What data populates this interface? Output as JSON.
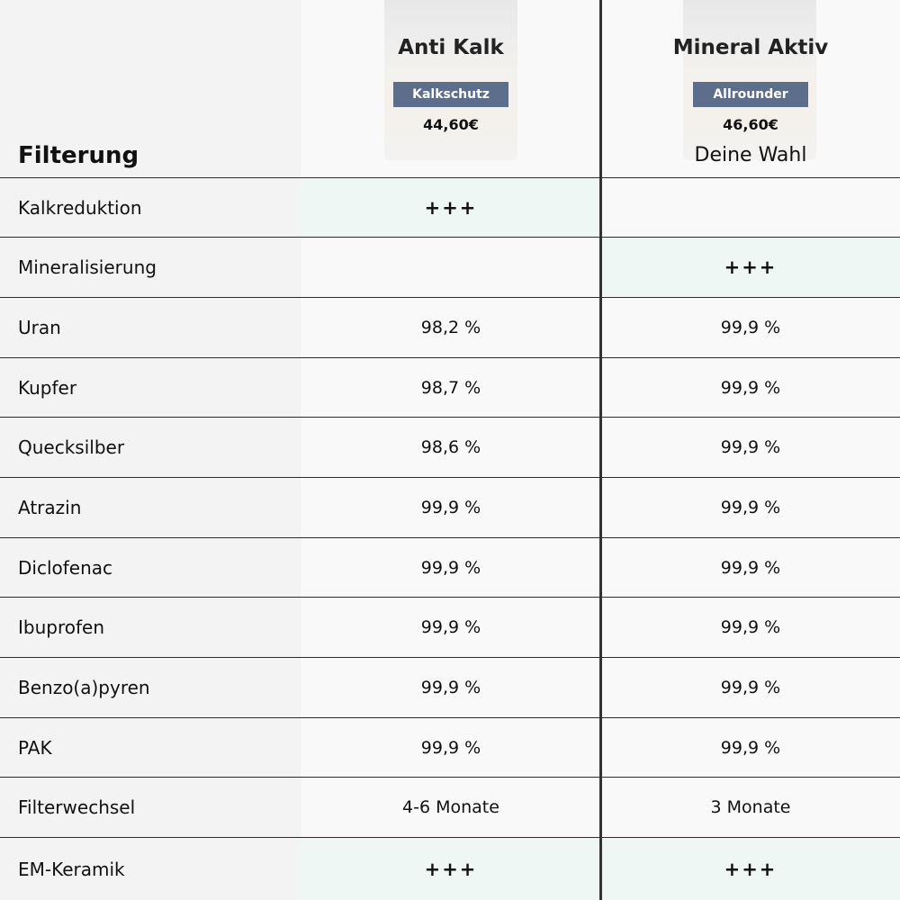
{
  "header": {
    "label": "Filterung",
    "products": [
      {
        "name": "Anti Kalk",
        "badge": "Kalkschutz",
        "price": "44,60€",
        "note": ""
      },
      {
        "name": "Mineral Aktiv",
        "badge": "Allrounder",
        "price": "46,60€",
        "note": "Deine Wahl"
      }
    ]
  },
  "rows": [
    {
      "label": "Kalkreduktion",
      "a": "+++",
      "b": ""
    },
    {
      "label": "Mineralisierung",
      "a": "",
      "b": "+++"
    },
    {
      "label": "Uran",
      "a": "98,2 %",
      "b": "99,9 %"
    },
    {
      "label": "Kupfer",
      "a": "98,7 %",
      "b": "99,9 %"
    },
    {
      "label": "Quecksilber",
      "a": "98,6 %",
      "b": "99,9 %"
    },
    {
      "label": "Atrazin",
      "a": "99,9 %",
      "b": "99,9 %"
    },
    {
      "label": "Diclofenac",
      "a": "99,9 %",
      "b": "99,9 %"
    },
    {
      "label": "Ibuprofen",
      "a": "99,9 %",
      "b": "99,9 %"
    },
    {
      "label": "Benzo(a)pyren",
      "a": "99,9 %",
      "b": "99,9 %"
    },
    {
      "label": "PAK",
      "a": "99,9 %",
      "b": "99,9 %"
    },
    {
      "label": "Filterwechsel",
      "a": "4-6 Monate",
      "b": "3 Monate"
    },
    {
      "label": "EM-Keramik",
      "a": "+++",
      "b": "+++"
    }
  ],
  "colors": {
    "badge": "#5d6e8c",
    "highlight": "#eef7f3",
    "divider": "#333333"
  }
}
